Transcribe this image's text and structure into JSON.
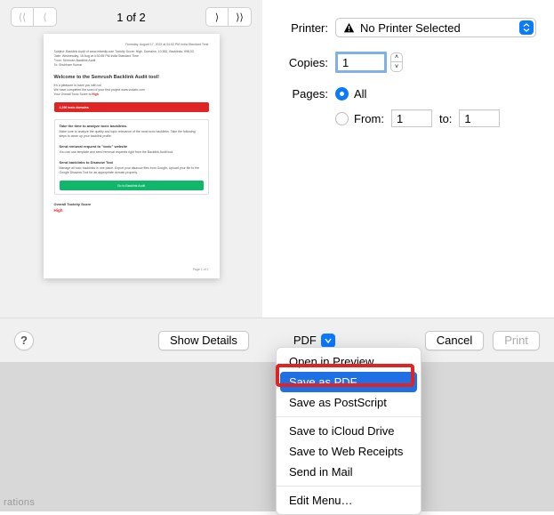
{
  "preview": {
    "page_indicator": "1 of 2",
    "doc": {
      "date": "Thursday, August 17, 2023 at 04:52 PM India Standard Time",
      "meta1": "Subject:  Backlink Audit of www.infamily.com Toxicity Score: High, Domains: 10,382, Backlinks: 998,03",
      "meta2": "Date:  Wednesday, 16 Aug at 4:30:55 PM India Standard Time",
      "meta3": "From:  Semrush Backlink Audit",
      "meta4": "To:  Shubham Kumar",
      "title": "Welcome to the Semrush Backlink Audit tool!",
      "sub1": "It's a pleasure to have you with us!",
      "sub2": "We have completed the scan of your first project www.vodafo.com",
      "sub3_a": "Your Overall Toxic Score is ",
      "sub3_b": "High",
      "redbar_text": "4,198 toxic domains",
      "box_h": "Take the time to analyze toxic backlinks.",
      "box_p": "Make sure to analyze the quality and topic relevance of the most toxic backlinks. Take the following steps to clean up your backlink profile.",
      "box2_h": "Send removal request to \"toxic\" website",
      "box2_p": "You can use template and send removal requests right from the Backlink Audit tool.",
      "box3_h": "Send backlinks to Disavow Tool",
      "box3_p": "Manage all toxic backlinks in one place. Export your disavow files from Google. Upload your file to the Google Disavow Tool for an appropriate domain property.",
      "greenbtn": "Go to Backlink Audit",
      "score_label": "Overall Toxicity Score",
      "score_value": "High",
      "pagefoot": "Page 1 of 2"
    }
  },
  "settings": {
    "printer_label": "Printer:",
    "printer_value": "No Printer Selected",
    "copies_label": "Copies:",
    "copies_value": "1",
    "pages_label": "Pages:",
    "pages_all": "All",
    "pages_from_label": "From:",
    "pages_from_value": "1",
    "pages_to_label": "to:",
    "pages_to_value": "1"
  },
  "bottombar": {
    "help": "?",
    "show_details": "Show Details",
    "pdf_label": "PDF",
    "cancel": "Cancel",
    "print": "Print"
  },
  "menu": {
    "open_preview": "Open in Preview",
    "save_pdf": "Save as PDF",
    "save_ps": "Save as PostScript",
    "icloud": "Save to iCloud Drive",
    "web_receipts": "Save to Web Receipts",
    "send_mail": "Send in Mail",
    "edit_menu": "Edit Menu…"
  },
  "corner_text": "rations"
}
